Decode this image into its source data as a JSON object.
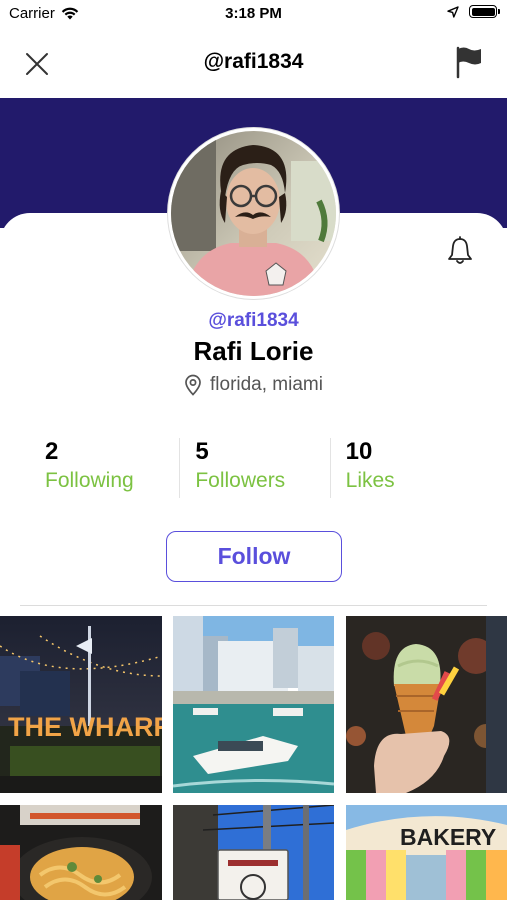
{
  "status_bar": {
    "carrier": "Carrier",
    "time": "3:18 PM"
  },
  "nav": {
    "title": "@rafi1834"
  },
  "profile": {
    "handle": "@rafi1834",
    "name": "Rafi Lorie",
    "location": "florida, miami"
  },
  "stats": [
    {
      "value": "2",
      "label": "Following"
    },
    {
      "value": "5",
      "label": "Followers"
    },
    {
      "value": "10",
      "label": "Likes"
    }
  ],
  "follow_button": "Follow",
  "photos": [
    {
      "name": "wharf-night-photo",
      "sign_text": "THE WHARF"
    },
    {
      "name": "yacht-marina-photo"
    },
    {
      "name": "ice-cream-taiyaki-photo"
    },
    {
      "name": "noodles-dish-photo"
    },
    {
      "name": "street-sign-photo"
    },
    {
      "name": "bakery-storefront-photo",
      "sign_text": "BAKERY"
    }
  ],
  "colors": {
    "header_band": "#221a6b",
    "accent": "#5a4fdc",
    "stat_label": "#7cc242"
  }
}
